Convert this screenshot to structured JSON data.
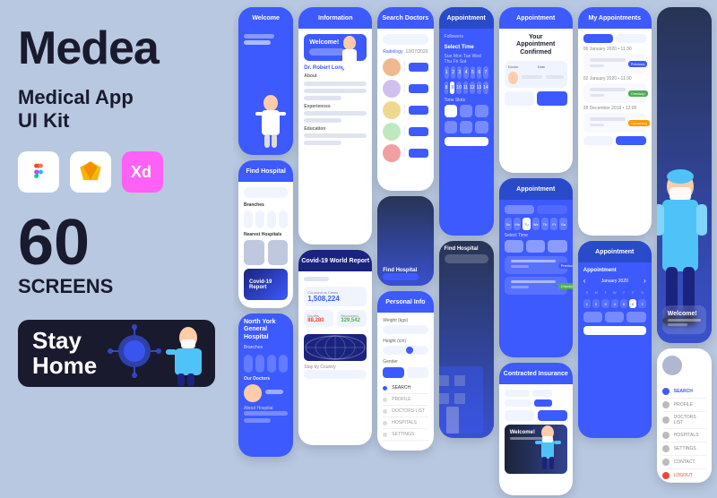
{
  "brand": {
    "title": "Medea",
    "subtitle_line1": "Medical App",
    "subtitle_line2": "UI Kit"
  },
  "tools": [
    {
      "name": "figma",
      "label": "Figma"
    },
    {
      "name": "sketch",
      "label": "Sketch"
    },
    {
      "name": "xd",
      "label": "Xd"
    }
  ],
  "screens": {
    "count": "60",
    "label": "SCREENS"
  },
  "banner": {
    "line1": "Stay",
    "line2": "Home"
  },
  "phones": {
    "col1_header": "Find Hospital",
    "col2_header": "Information",
    "col3_header": "Search Doctors",
    "col4_header": "Appointment",
    "col5_header": "Appointment",
    "col6_header": "My Appointments",
    "col7_header": "Welcome",
    "doctor_name": "Dr. Robert Long",
    "hospital_name1": "North York General Hospital",
    "covid_label": "Covid-19",
    "cases_label": "Coronavirus Cases",
    "cases_number": "1,508,224",
    "deaths_label": "Deaths",
    "deaths_number": "88,280",
    "recovered_label": "Recovered",
    "recovered_number": "329,542"
  },
  "colors": {
    "primary": "#3d5afe",
    "dark": "#1a1a2e",
    "background": "#b8c8e0",
    "white": "#ffffff"
  }
}
